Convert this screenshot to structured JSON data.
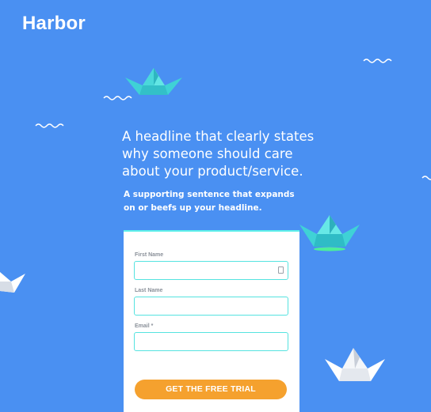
{
  "brand": {
    "logo_text": "Harbor"
  },
  "hero": {
    "headline": "A headline that clearly states why someone should care about your product/service.",
    "supporting": "A supporting sentence that expands on or beefs up your headline."
  },
  "form": {
    "first_name_label": "First Name",
    "last_name_label": "Last Name",
    "email_label": "Email *",
    "first_name_value": "",
    "last_name_value": "",
    "email_value": "",
    "submit_label": "GET THE FREE TRIAL"
  },
  "colors": {
    "background": "#4a90f2",
    "accent_teal": "#55e3e0",
    "cta_orange": "#f5a12e"
  },
  "decorations": {
    "boat_icon": "paper-boat-icon",
    "wave_icon": "wave-icon"
  }
}
